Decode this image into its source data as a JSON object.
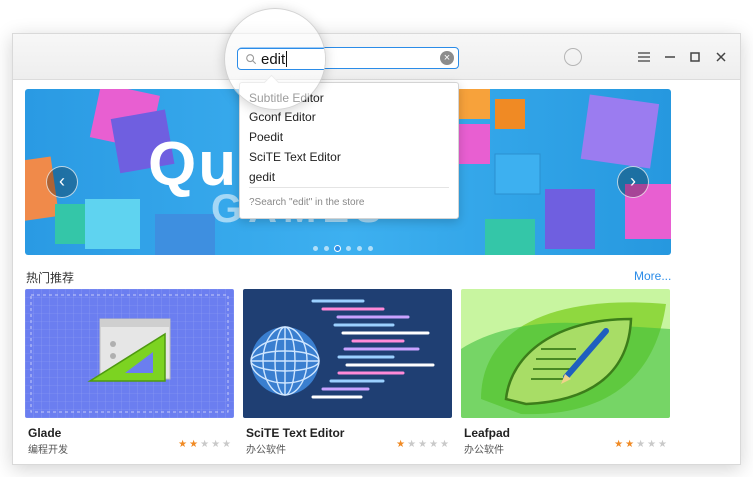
{
  "search": {
    "value": "edit",
    "icon": "search-icon",
    "clear_icon": "clear-icon"
  },
  "titlebar": {
    "icons": [
      "user-icon",
      "menu-icon",
      "minimize-icon",
      "maximize-icon",
      "close-icon"
    ]
  },
  "suggestions": {
    "items": [
      "Subtitle Editor",
      "Gconf Editor",
      "Poedit",
      "SciTE Text Editor",
      "gedit"
    ],
    "store_search": "?Search \"edit\" in the store"
  },
  "banner": {
    "title": "Qu",
    "subtitle": "GAMES",
    "slides": 6,
    "active_slide": 3
  },
  "section": {
    "title": "热门推荐",
    "more_label": "More..."
  },
  "apps": [
    {
      "name": "Glade",
      "category": "编程开发",
      "rating": 2,
      "max_rating": 5
    },
    {
      "name": "SciTE Text Editor",
      "category": "办公软件",
      "rating": 1,
      "max_rating": 5
    },
    {
      "name": "Leafpad",
      "category": "办公软件",
      "rating": 2,
      "max_rating": 5
    }
  ],
  "colors": {
    "accent": "#2b8ce8",
    "star_on": "#f08a24",
    "star_off": "#c9c9c9"
  }
}
